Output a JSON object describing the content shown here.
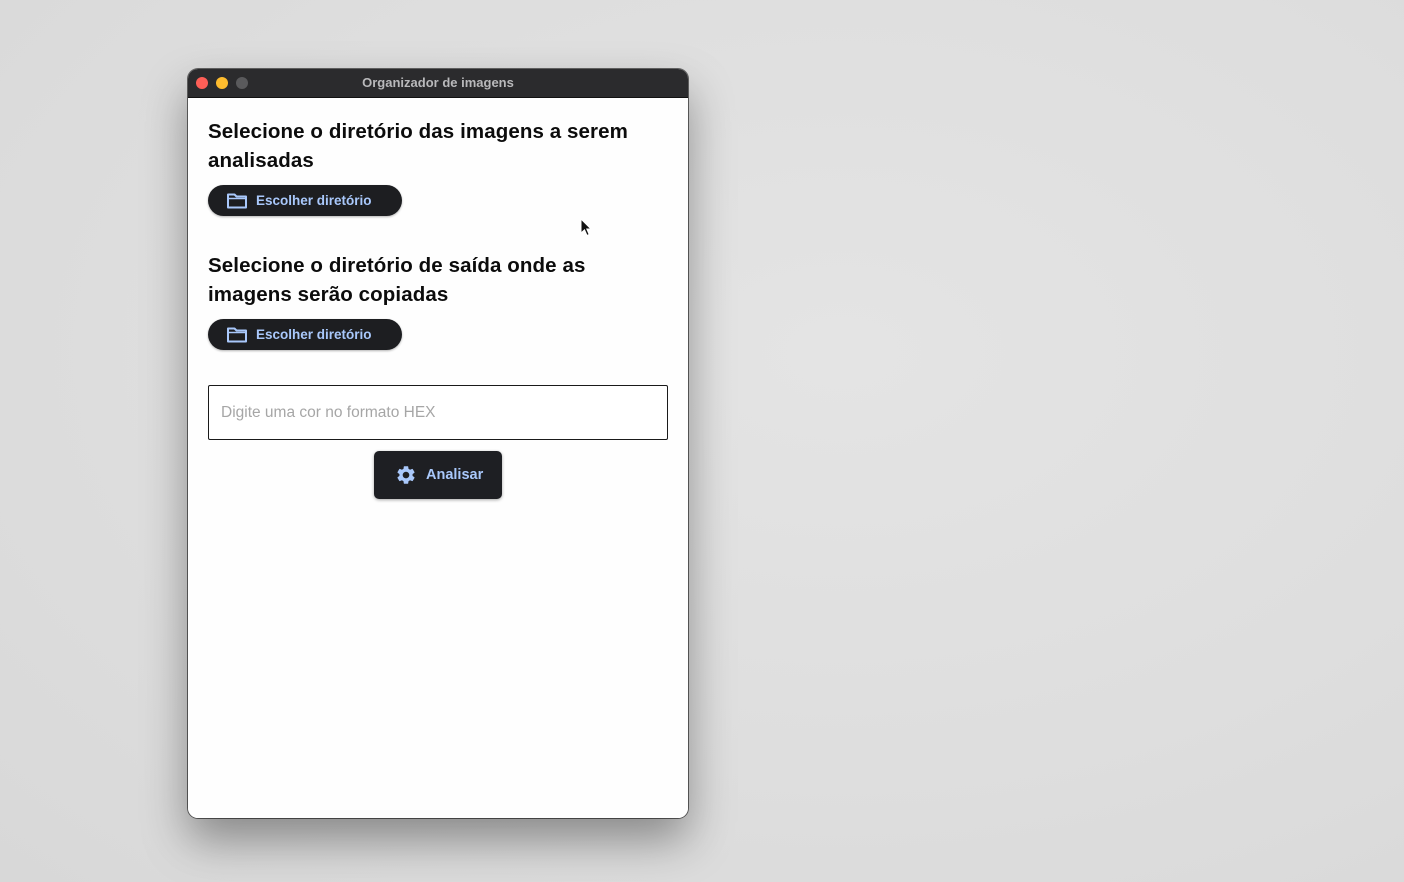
{
  "window": {
    "title": "Organizador de imagens"
  },
  "source_section": {
    "heading": "Selecione o diretório das imagens a serem analisadas",
    "button_label": "Escolher diretório",
    "button_icon": "folder-icon"
  },
  "output_section": {
    "heading": "Selecione o diretório de saída onde as imagens serão copiadas",
    "button_label": "Escolher diretório",
    "button_icon": "folder-icon"
  },
  "hex_field": {
    "value": "",
    "placeholder": "Digite uma cor no formato HEX"
  },
  "analyze_button": {
    "label": "Analisar",
    "icon": "gear-icon"
  },
  "colors": {
    "button_bg": "#1d1e21",
    "button_text": "#a9c8fb",
    "titlebar_bg": "#2b2b2d",
    "close": "#fe5f57",
    "minimize": "#febc2e"
  }
}
